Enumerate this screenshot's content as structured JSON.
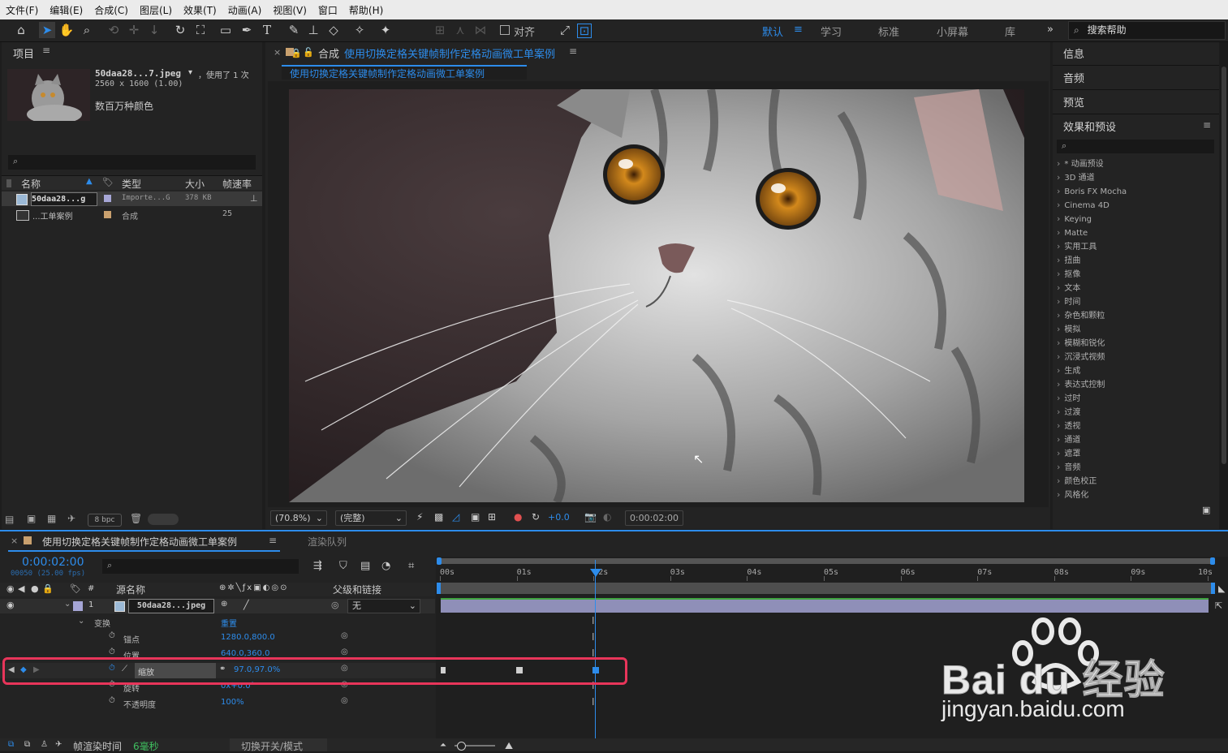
{
  "menu": [
    "文件(F)",
    "编辑(E)",
    "合成(C)",
    "图层(L)",
    "效果(T)",
    "动画(A)",
    "视图(V)",
    "窗口",
    "帮助(H)"
  ],
  "toolbar": {
    "align_label": "对齐",
    "workspaces": [
      "默认",
      "学习",
      "标准",
      "小屏幕",
      "库"
    ],
    "active_workspace": "默认",
    "search_help": "搜索帮助"
  },
  "project": {
    "title": "项目",
    "selected_name": "50daa28...7.jpeg",
    "used": "，使用了 1 次",
    "dims": "2560 x 1600 (1.00)",
    "color": "数百万种颜色",
    "columns": [
      "名称",
      "类型",
      "大小",
      "帧速率"
    ],
    "rows": [
      {
        "name": "50daa28...g",
        "type": "Importe...G",
        "size": "378 KB",
        "fps": ""
      },
      {
        "name": "...工单案例",
        "type": "合成",
        "size": "",
        "fps": "25"
      }
    ],
    "bpc": "8 bpc"
  },
  "comp": {
    "prefix": "合成",
    "name": "使用切换定格关键帧制作定格动画微工单案例",
    "tab": "使用切换定格关键帧制作定格动画微工单案例",
    "zoom": "(70.8%)",
    "quality": "(完整)",
    "exposure": "+0.0",
    "timecode": "0:00:02:00"
  },
  "right_panels": {
    "items": [
      "信息",
      "音频",
      "预览"
    ],
    "effects_title": "效果和预设"
  },
  "effects": [
    "* 动画预设",
    "3D 通道",
    "Boris FX Mocha",
    "Cinema 4D",
    "Keying",
    "Matte",
    "实用工具",
    "扭曲",
    "抠像",
    "文本",
    "时间",
    "杂色和颗粒",
    "模拟",
    "模糊和锐化",
    "沉浸式视频",
    "生成",
    "表达式控制",
    "过时",
    "过渡",
    "透视",
    "通道",
    "遮罩",
    "音频",
    "颜色校正",
    "风格化"
  ],
  "timeline": {
    "tab": "使用切换定格关键帧制作定格动画微工单案例",
    "render_queue": "渲染队列",
    "timecode": "0:00:02:00",
    "frame_info": "00050 (25.00 fps)",
    "col_source": "源名称",
    "col_parent": "父级和链接",
    "layer_num": "1",
    "layer_name": "50daa28...jpeg",
    "parent_value": "无",
    "transform": "变换",
    "reset": "重置",
    "props": [
      {
        "name": "锚点",
        "value": "1280.0,800.0"
      },
      {
        "name": "位置",
        "value": "640.0,360.0"
      },
      {
        "name": "缩放",
        "value": "97.0,97.0%"
      },
      {
        "name": "旋转",
        "value": "0x+0.0°"
      },
      {
        "name": "不透明度",
        "value": "100%"
      }
    ],
    "ruler": [
      "00s",
      "01s",
      "02s",
      "03s",
      "04s",
      "05s",
      "06s",
      "07s",
      "08s",
      "09s",
      "10s"
    ],
    "footer_label": "帧渲染时间",
    "footer_value": "6毫秒",
    "toggle_label": "切换开关/模式"
  },
  "watermark": {
    "brand": "Bai du 经验",
    "url": "jingyan.baidu.com"
  },
  "colors": {
    "accent": "#2d8ceb",
    "highlight_box": "#e8355a",
    "layer_bar": "#8f8fb8"
  }
}
